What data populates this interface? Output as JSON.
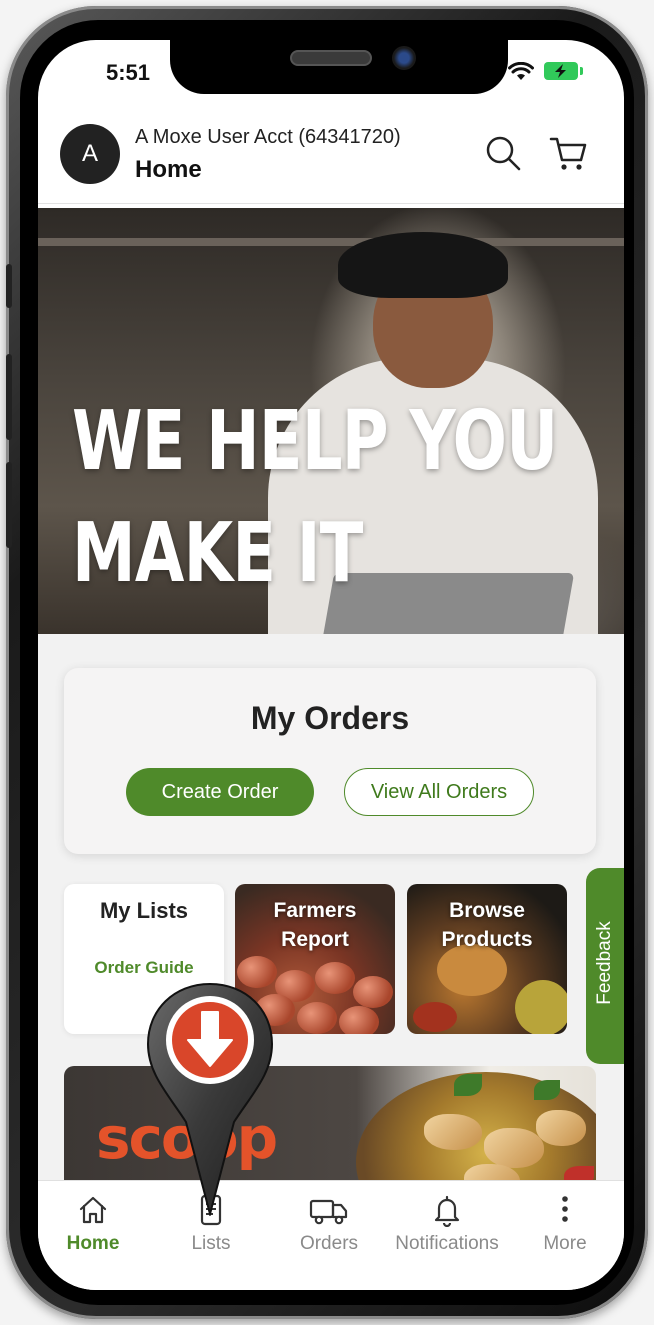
{
  "status": {
    "time": "5:51"
  },
  "header": {
    "avatar_letter": "A",
    "account": "A Moxe User Acct (64341720)",
    "title": "Home",
    "search_icon": "search-icon",
    "cart_icon": "cart-icon"
  },
  "hero": {
    "line1": "WE HELP YOU",
    "line2": "MAKE IT"
  },
  "orders": {
    "title": "My Orders",
    "create_label": "Create Order",
    "view_all_label": "View All Orders"
  },
  "tiles": {
    "lists_title": "My Lists",
    "lists_link": "Order Guide",
    "farmers_title_1": "Farmers",
    "farmers_title_2": "Report",
    "browse_title_1": "Browse",
    "browse_title_2": "Products"
  },
  "feedback_label": "Feedback",
  "banner": {
    "brand": "scoop"
  },
  "tabs": [
    {
      "label": "Home",
      "icon": "home-icon",
      "active": true
    },
    {
      "label": "Lists",
      "icon": "list-icon",
      "active": false
    },
    {
      "label": "Orders",
      "icon": "truck-icon",
      "active": false
    },
    {
      "label": "Notifications",
      "icon": "bell-icon",
      "active": false
    },
    {
      "label": "More",
      "icon": "more-icon",
      "active": false
    }
  ],
  "colors": {
    "accent": "#4f8a2a",
    "pin": "#d9462a",
    "brand_scoop": "#e4532a"
  }
}
